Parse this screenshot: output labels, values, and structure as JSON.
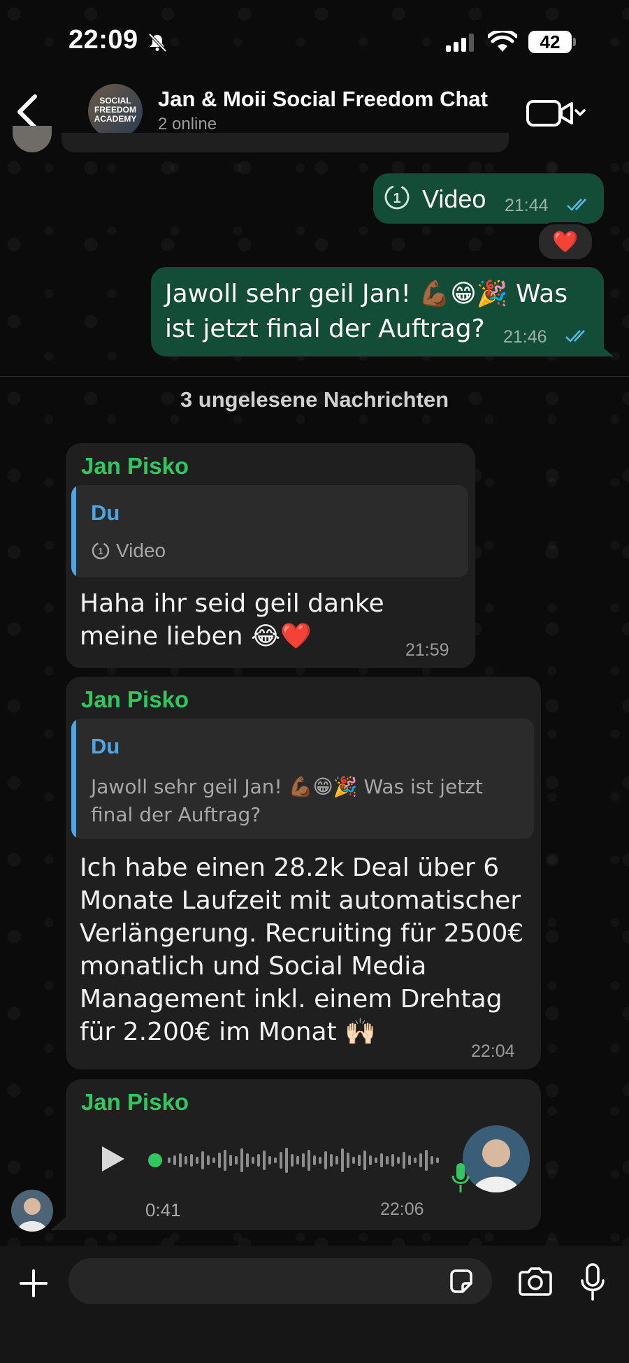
{
  "status_bar": {
    "time": "22:09",
    "battery": "42",
    "signal_bars": 3,
    "icons": [
      "bell-off-icon",
      "signal-icon",
      "wifi-icon",
      "battery-icon"
    ]
  },
  "header": {
    "avatar_text": "SOCIAL FREEDOM ACADEMY",
    "title": "Jan & Moii Social Freedom Chat",
    "subtitle": "2 online",
    "icons": [
      "back-icon",
      "video-call-icon",
      "chevron-down-icon"
    ]
  },
  "messages": {
    "out_video": {
      "label": "Video",
      "time": "21:44",
      "status": "read",
      "reaction": "❤️"
    },
    "out_jawoll": {
      "text": "Jawoll sehr geil Jan! 💪🏾😁🎉 Was ist jetzt final der Auftrag?",
      "time": "21:46",
      "status": "read"
    },
    "unread_divider": "3 ungelesene Nachrichten",
    "in1": {
      "sender": "Jan Pisko",
      "quote_author": "Du",
      "quote_text": "Video",
      "text": "Haha ihr seid geil danke meine lieben 😂❤️",
      "time": "21:59"
    },
    "in2": {
      "sender": "Jan Pisko",
      "quote_author": "Du",
      "quote_text": "Jawoll sehr geil Jan! 💪🏾😁🎉 Was ist jetzt final der Auftrag?",
      "text": "Ich habe einen 28.2k Deal über 6 Monate Laufzeit mit automatischer Verlängerung. Recruiting für 2500€ monatlich und Social Media Management inkl. einem Drehtag für 2.200€ im Monat 🙌🏻",
      "time": "22:04"
    },
    "in3": {
      "sender": "Jan Pisko",
      "duration": "0:41",
      "time": "22:06",
      "played_fraction": 0.0
    }
  },
  "composer": {
    "placeholder": "",
    "icons": [
      "plus-icon",
      "sticker-icon",
      "camera-icon",
      "microphone-icon"
    ]
  },
  "colors": {
    "background": "#0b0b0b",
    "outgoing_bubble": "#134d37",
    "incoming_bubble": "#1f1f1f",
    "sender_name": "#31c65f",
    "quote_accent": "#4aa6e8",
    "read_ticks": "#53bdeb"
  }
}
